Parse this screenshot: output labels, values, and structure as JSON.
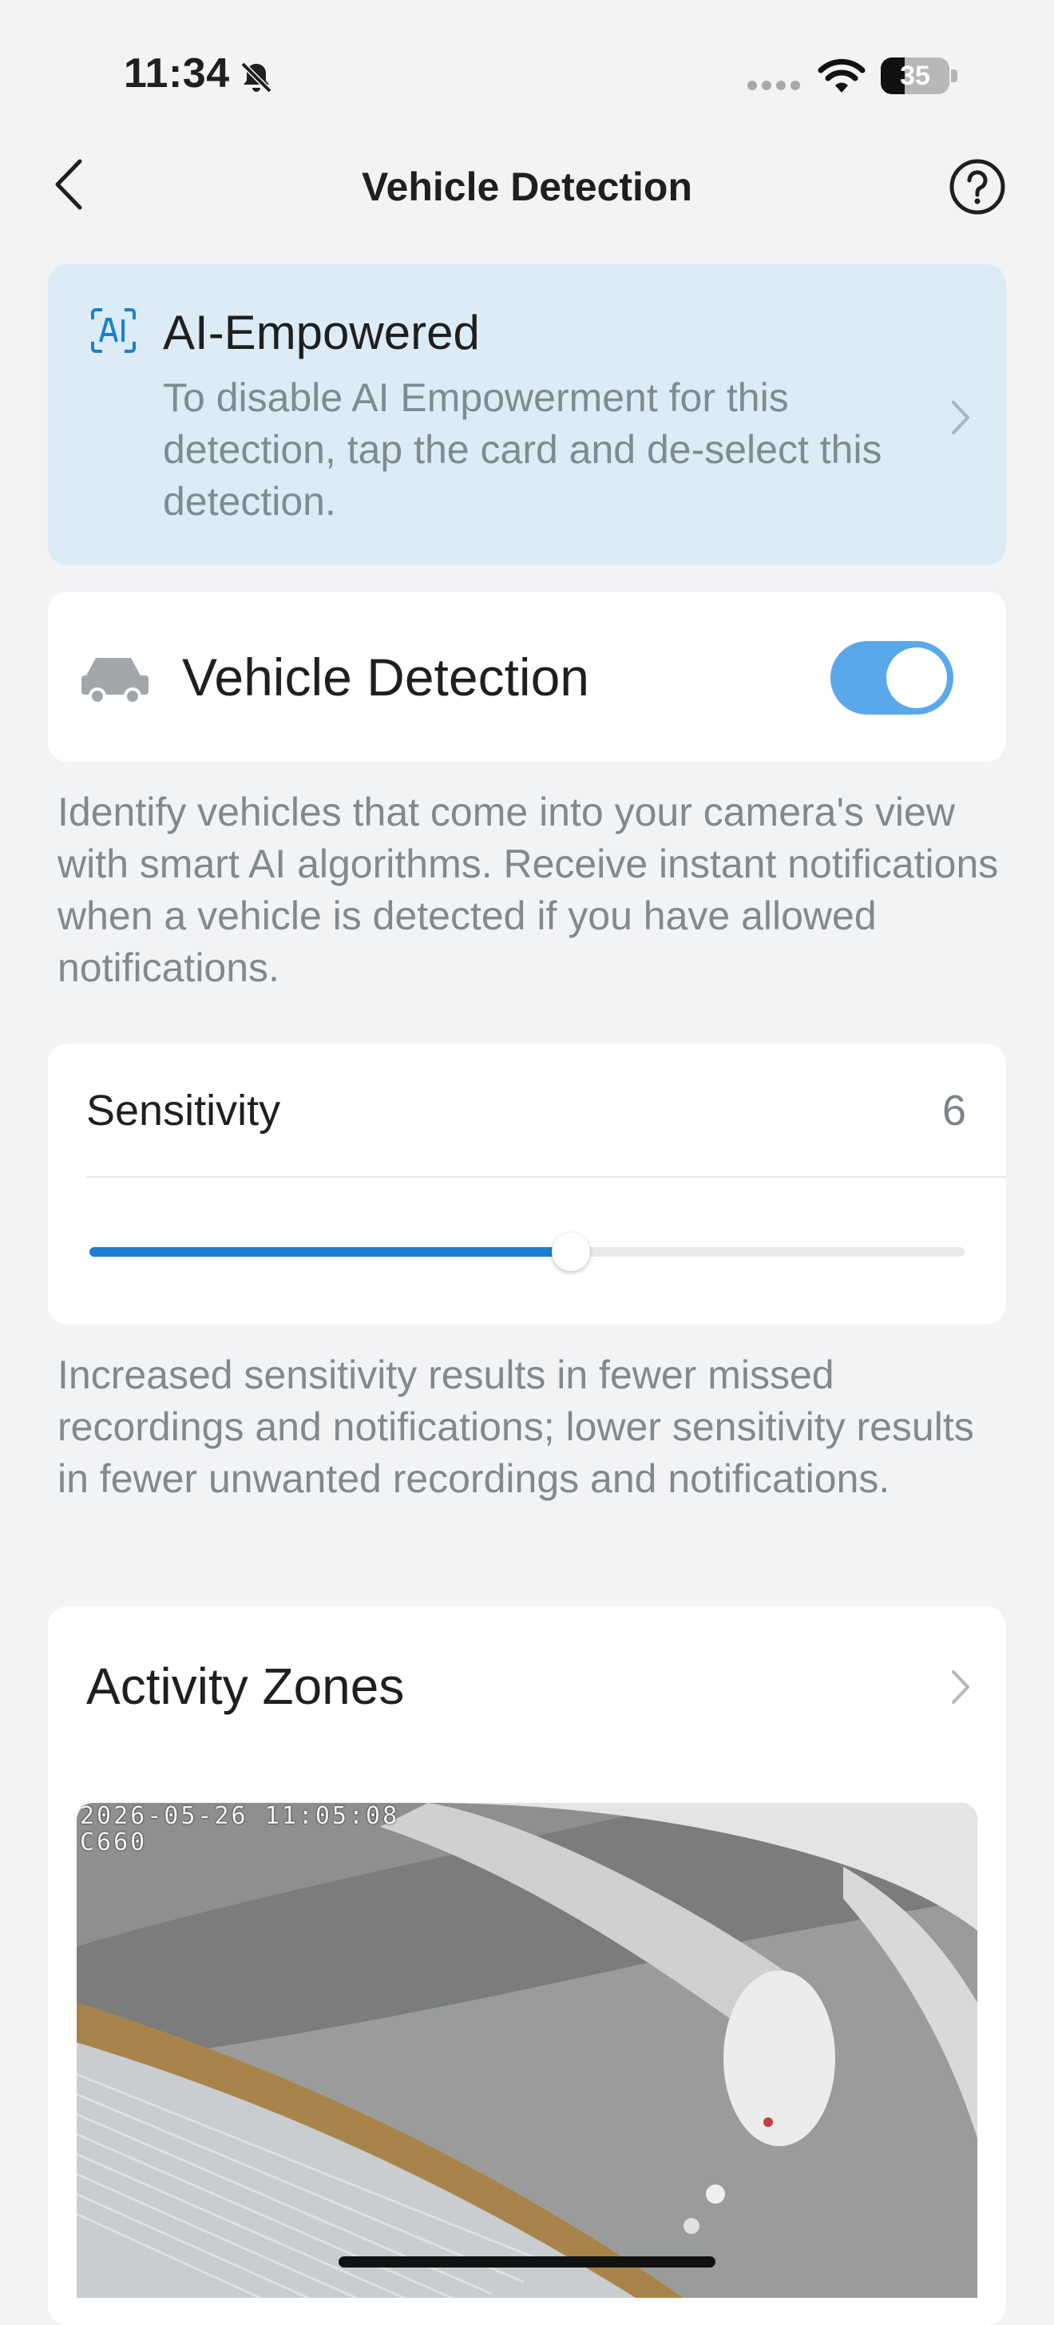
{
  "status_bar": {
    "time": "11:34",
    "battery_level": "35",
    "icons": [
      "bell-slash-icon",
      "cellular-dots-icon",
      "wifi-icon",
      "battery-icon"
    ]
  },
  "header": {
    "title": "Vehicle Detection",
    "back_icon": "chevron-left-icon",
    "help_icon": "question-circle-icon"
  },
  "ai_card": {
    "icon": "ai-badge-icon",
    "title": "AI-Empowered",
    "description": "To disable AI Empowerment for this detection, tap the card and de-select this detection."
  },
  "vehicle_detection": {
    "icon": "car-icon",
    "label": "Vehicle Detection",
    "enabled": true,
    "toggle_color": "#5aa7ea"
  },
  "vehicle_description": "Identify vehicles that come into your camera's view with smart AI algorithms. Receive instant notifications when a vehicle is detected if you have allowed notifications.",
  "sensitivity": {
    "label": "Sensitivity",
    "value": "6",
    "slider_fraction": 0.55,
    "accent": "#1a7fd4"
  },
  "sensitivity_description": "Increased sensitivity results in fewer missed recordings and notifications; lower sensitivity results in fewer unwanted recordings and notifications.",
  "activity_zones": {
    "label": "Activity Zones",
    "preview": {
      "timestamp": "2026-05-26 11:05:08",
      "camera_id": "C660"
    }
  }
}
